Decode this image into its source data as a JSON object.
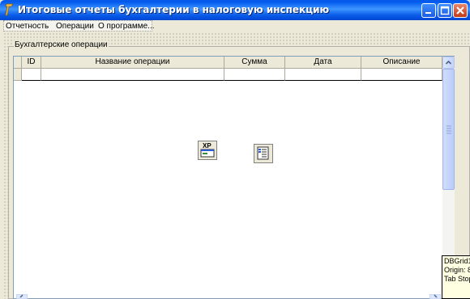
{
  "window": {
    "title": "Итоговые отчеты бухгалтерии в налоговую инспекцию",
    "controls": [
      "minimize-icon",
      "maximize-icon",
      "close-icon"
    ]
  },
  "menu": {
    "items": [
      {
        "label": "Отчетность"
      },
      {
        "label": "Операции"
      },
      {
        "label": "О программе..."
      }
    ]
  },
  "groupbox": {
    "label": "Бухгалтерские операции"
  },
  "grid": {
    "columns": [
      {
        "label": "ID"
      },
      {
        "label": "Название операции"
      },
      {
        "label": "Сумма"
      },
      {
        "label": "Дата"
      },
      {
        "label": "Описание"
      }
    ]
  },
  "components": [
    {
      "icon": "xp-manifest-icon",
      "label": "XP"
    },
    {
      "icon": "main-menu-component-icon"
    }
  ],
  "tooltip": {
    "lines": [
      "DBGrid1",
      "Origin: 8",
      "Tab Stop"
    ]
  },
  "colors": {
    "titlebar": "#0a5ce8",
    "window_bg": "#ece9d8",
    "tooltip_bg": "#ffffe1"
  }
}
